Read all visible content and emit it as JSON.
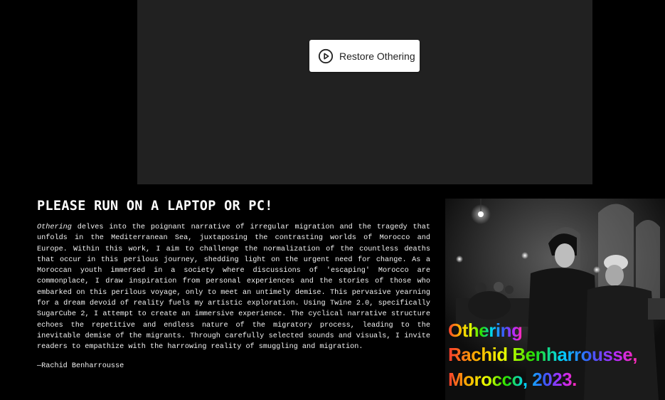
{
  "game": {
    "restore_label": "Restore Othering",
    "restore_icon": "play-circle-icon"
  },
  "intro": {
    "heading": "PLEASE RUN ON A LAPTOP OR PC!",
    "title_word": "Othering",
    "description": " delves into the poignant narrative of irregular migration and the tragedy that unfolds in the Mediterranean Sea, juxtaposing the contrasting worlds of Morocco and Europe. Within this work, I aim to challenge the normalization of the countless deaths that occur in this perilous journey, shedding light on the urgent need for change. As a Moroccan youth immersed in a society where discussions of 'escaping' Morocco are commonplace, I draw inspiration from personal experiences and the stories of those who embarked on this perilous voyage, only to meet an untimely demise. This pervasive yearning for a dream devoid of reality fuels my artistic exploration. Using Twine 2.0, specifically SugarCube 2, I attempt to create an immersive experience. The cyclical narrative structure echoes the repetitive and endless nature of the migratory process, leading to the inevitable demise of the migrants. Through carefully selected sounds and visuals, I invite readers to empathize with the harrowing reality of smuggling and migration.",
    "signature": "—Rachid Benharrousse"
  },
  "poster": {
    "line1": "Othering",
    "line2": "Rachid Benharrousse,",
    "line3": "Morocco, 2023.",
    "colors": [
      "#ff3b2f",
      "#ffb000",
      "#e8ff00",
      "#28e000",
      "#00d2ff",
      "#3a5bff",
      "#b12bff",
      "#ff2bb5"
    ]
  }
}
